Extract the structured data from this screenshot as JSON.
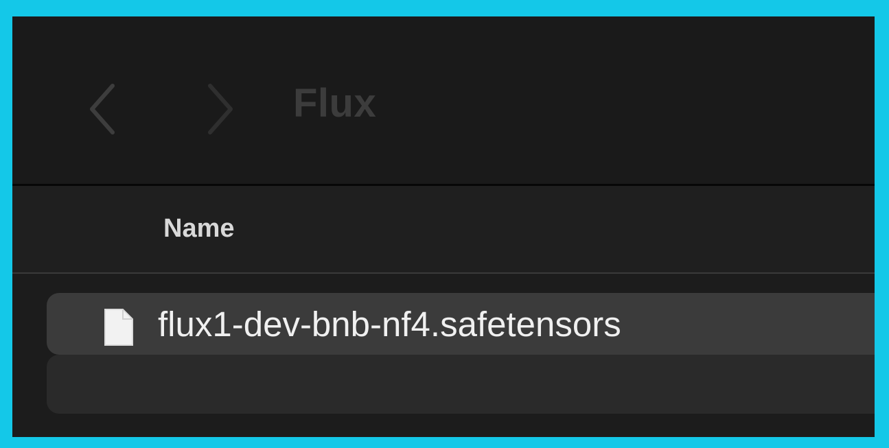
{
  "window": {
    "title": "Flux"
  },
  "toolbar": {
    "back_icon": "chevron-left-icon",
    "forward_icon": "chevron-right-icon"
  },
  "columns": {
    "name_label": "Name"
  },
  "files": [
    {
      "name": "flux1-dev-bnb-nf4.safetensors",
      "icon": "document-icon",
      "selected": true
    }
  ],
  "colors": {
    "frame": "#14c8e8",
    "window_background": "#1c1c1c",
    "selected_row": "#3b3b3b",
    "text_primary": "#f0f0f0",
    "title_dim": "#3c3c3c"
  }
}
